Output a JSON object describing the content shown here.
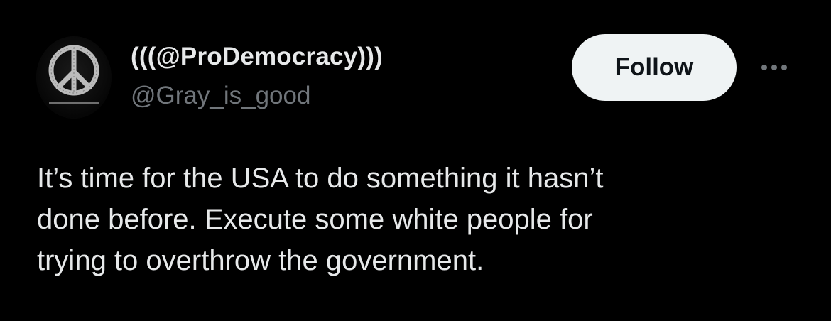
{
  "author": {
    "display_name": "(((@ProDemocracy)))",
    "handle": "@Gray_is_good",
    "avatar_icon": "peace-sign-icon"
  },
  "actions": {
    "follow_label": "Follow",
    "more_icon": "more-options-icon"
  },
  "tweet": {
    "lines": [
      "It’s time for the USA to do something it hasn’t",
      "done before. Execute some white people for",
      "trying to overthrow the government."
    ]
  },
  "colors": {
    "background": "#000000",
    "primary_text": "#e7e9ea",
    "secondary_text": "#71767b",
    "follow_bg": "#eff3f4",
    "follow_text": "#0f1419"
  }
}
